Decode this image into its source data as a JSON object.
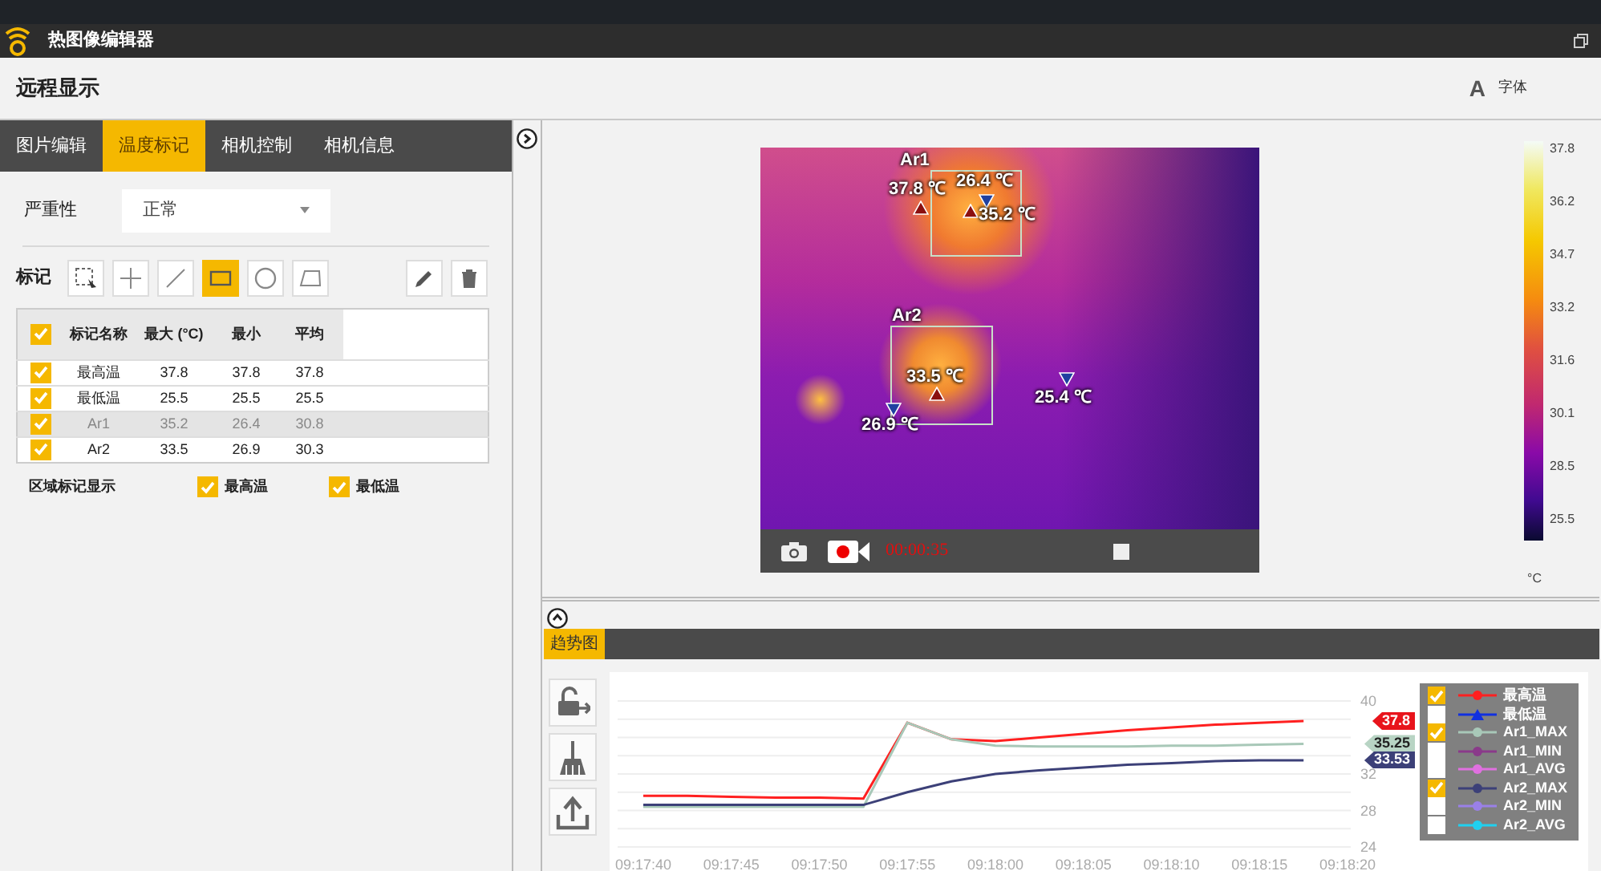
{
  "app": {
    "title": "热图像编辑器"
  },
  "header": {
    "title": "远程显示",
    "font_icon": "A",
    "font_label": "字体"
  },
  "left_panel": {
    "tabs": [
      {
        "label": "图片编辑",
        "selected": false
      },
      {
        "label": "温度标记",
        "selected": true
      },
      {
        "label": "相机控制",
        "selected": false
      },
      {
        "label": "相机信息",
        "selected": false
      }
    ],
    "severity": {
      "label": "严重性",
      "value": "正常"
    },
    "marks": {
      "label": "标记",
      "tools": [
        {
          "kind": "select",
          "selected": false
        },
        {
          "kind": "point",
          "selected": false
        },
        {
          "kind": "line",
          "selected": false
        },
        {
          "kind": "rectangle",
          "selected": true
        },
        {
          "kind": "circle",
          "selected": false
        },
        {
          "kind": "polygon",
          "selected": false
        }
      ],
      "actions": [
        {
          "kind": "edit"
        },
        {
          "kind": "delete"
        }
      ]
    },
    "table": {
      "all_checked": true,
      "columns": [
        "标记名称",
        "最大 (°C)",
        "最小",
        "平均"
      ],
      "rows": [
        {
          "checked": true,
          "selected": false,
          "cells": [
            "最高温",
            "37.8",
            "37.8",
            "37.8"
          ]
        },
        {
          "checked": true,
          "selected": false,
          "cells": [
            "最低温",
            "25.5",
            "25.5",
            "25.5"
          ]
        },
        {
          "checked": true,
          "selected": true,
          "cells": [
            "Ar1",
            "35.2",
            "26.4",
            "30.8"
          ]
        },
        {
          "checked": true,
          "selected": false,
          "cells": [
            "Ar2",
            "33.5",
            "26.9",
            "30.3"
          ]
        }
      ]
    },
    "region_display": {
      "label": "区域标记显示",
      "options": [
        {
          "label": "最高温",
          "checked": true
        },
        {
          "label": "最低温",
          "checked": true
        }
      ]
    }
  },
  "viewer": {
    "regions": [
      {
        "label": "Ar1"
      },
      {
        "label": "Ar2"
      }
    ],
    "points": [
      {
        "kind": "max",
        "text": "37.8 ℃"
      },
      {
        "kind": "min",
        "text": "26.4 ℃"
      },
      {
        "kind": "max",
        "text": "35.2 ℃"
      },
      {
        "kind": "max",
        "text": "33.5 ℃"
      },
      {
        "kind": "min",
        "text": "26.9 ℃"
      },
      {
        "kind": "min",
        "text": "25.4 ℃"
      }
    ],
    "timer": "00:00:35",
    "color_scale": {
      "ticks": [
        "37.8",
        "36.2",
        "34.7",
        "33.2",
        "31.6",
        "30.1",
        "28.5",
        "25.5"
      ],
      "unit": "°C"
    }
  },
  "trend": {
    "tabs": [
      {
        "label": "趋势图",
        "selected": true
      }
    ],
    "chart_data": {
      "type": "line",
      "categories": [
        "09:17:40",
        null,
        "09:17:45",
        null,
        "09:17:50",
        null,
        "09:17:55",
        null,
        "09:18:00",
        null,
        "09:18:05",
        null,
        "09:18:10",
        null,
        "09:18:15",
        null,
        "09:18:20"
      ],
      "grid": true,
      "ylim": [
        24,
        40
      ],
      "yticks": [
        24,
        28,
        32,
        40
      ],
      "series": [
        {
          "name": "最高温",
          "color": "#ff2020",
          "values": [
            29.6,
            29.6,
            29.5,
            29.4,
            29.4,
            29.3,
            37.6,
            35.8,
            35.6,
            36.0,
            36.4,
            36.8,
            37.1,
            37.4,
            37.6,
            37.8,
            null
          ]
        },
        {
          "name": "最低温",
          "color": "#1030e0",
          "values": [
            null,
            null,
            null,
            null,
            null,
            null,
            null,
            null,
            null,
            null,
            null,
            null,
            null,
            null,
            null,
            null,
            null
          ]
        },
        {
          "name": "Ar1_MAX",
          "color": "#a8c8b8",
          "values": [
            28.4,
            28.4,
            28.4,
            28.4,
            28.4,
            28.4,
            37.6,
            35.8,
            35.1,
            35.0,
            35.0,
            35.0,
            35.1,
            35.1,
            35.2,
            35.3,
            null
          ]
        },
        {
          "name": "Ar1_MIN",
          "color": "#8a3a8a",
          "values": [
            null,
            null,
            null,
            null,
            null,
            null,
            null,
            null,
            null,
            null,
            null,
            null,
            null,
            null,
            null,
            null,
            null
          ]
        },
        {
          "name": "Ar1_AVG",
          "color": "#e070e0",
          "values": [
            null,
            null,
            null,
            null,
            null,
            null,
            null,
            null,
            null,
            null,
            null,
            null,
            null,
            null,
            null,
            null,
            null
          ]
        },
        {
          "name": "Ar2_MAX",
          "color": "#3c4078",
          "values": [
            28.6,
            28.6,
            28.6,
            28.6,
            28.6,
            28.6,
            30.0,
            31.2,
            32.0,
            32.4,
            32.7,
            33.0,
            33.2,
            33.4,
            33.5,
            33.5,
            null
          ]
        },
        {
          "name": "Ar2_MIN",
          "color": "#9a80e8",
          "values": [
            null,
            null,
            null,
            null,
            null,
            null,
            null,
            null,
            null,
            null,
            null,
            null,
            null,
            null,
            null,
            null,
            null
          ]
        },
        {
          "name": "Ar2_AVG",
          "color": "#20d0f0",
          "values": [
            null,
            null,
            null,
            null,
            null,
            null,
            null,
            null,
            null,
            null,
            null,
            null,
            null,
            null,
            null,
            null,
            null
          ]
        }
      ]
    },
    "value_tags": [
      {
        "text": "37.8",
        "color": "#e8141c"
      },
      {
        "text": "35.25",
        "color": "#b8d4c4"
      },
      {
        "text": "33.53",
        "color": "#3c4078"
      }
    ],
    "legend": [
      {
        "kind": "circle",
        "checked": true
      },
      {
        "kind": "triangle",
        "checked": false
      },
      {
        "kind": "circle",
        "checked": true
      },
      {
        "kind": "circle",
        "checked": false
      },
      {
        "kind": "circle",
        "checked": false
      },
      {
        "kind": "circle",
        "checked": true
      },
      {
        "kind": "circle",
        "checked": false
      },
      {
        "kind": "circle",
        "checked": false
      }
    ]
  }
}
